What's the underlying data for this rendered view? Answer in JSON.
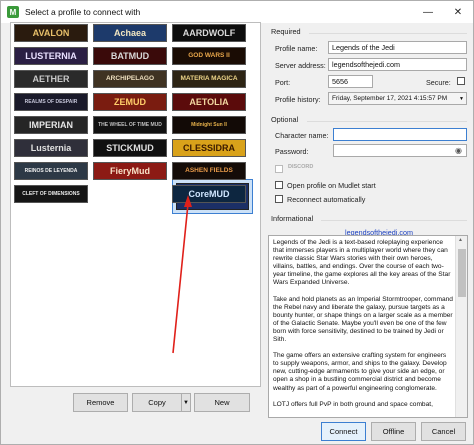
{
  "window": {
    "title": "Select a profile to connect with",
    "app_icon": "mudlet-icon",
    "minimize_glyph": "—",
    "close_glyph": "✕"
  },
  "tiles": [
    {
      "text": "AVALON",
      "bg": "#2a1b0e",
      "fg": "#e8c06a"
    },
    {
      "text": "Achaea",
      "bg": "#1d3a6b",
      "fg": "#f3e7c2"
    },
    {
      "text": "AARDWOLF",
      "bg": "#0d0d0d",
      "fg": "#d9d9d9"
    },
    {
      "text": "LUSTERNIA",
      "bg": "#2b1f44",
      "fg": "#e9e0ff"
    },
    {
      "text": "BATMUD",
      "bg": "#3a0a0a",
      "fg": "#d8d8d8"
    },
    {
      "text": "GOD WARS II",
      "bg": "#1a0c04",
      "fg": "#e8a64a"
    },
    {
      "text": "AETHER",
      "bg": "#2a2a2a",
      "fg": "#c9c9c9"
    },
    {
      "text": "ARCHIPELAGO",
      "bg": "#3f3222",
      "fg": "#efe0c0"
    },
    {
      "text": "MATERIA MAGICA",
      "bg": "#2d2414",
      "fg": "#f0d78a"
    },
    {
      "text": "REALMS OF DESPAIR",
      "bg": "#1a1a2a",
      "fg": "#c5c5d8"
    },
    {
      "text": "ZEMUD",
      "bg": "#7a1c10",
      "fg": "#ffce6a"
    },
    {
      "text": "AETOLIA",
      "bg": "#5b0b0b",
      "fg": "#f2d7a0"
    },
    {
      "text": "IMPERIAN",
      "bg": "#252525",
      "fg": "#e6e6e6"
    },
    {
      "text": "THE WHEEL OF TIME MUD",
      "bg": "#111111",
      "fg": "#bfbfbf"
    },
    {
      "text": "Midnight Sun II",
      "bg": "#120a06",
      "fg": "#e6b04a"
    },
    {
      "text": "Lusternia",
      "bg": "#2f2f3a",
      "fg": "#e0e0e0"
    },
    {
      "text": "STICKMUD",
      "bg": "#101010",
      "fg": "#e0e0e0"
    },
    {
      "text": "CLESSIDRA",
      "bg": "#d9a21a",
      "fg": "#3a1a00"
    },
    {
      "text": "REINOS DE LEYENDA",
      "bg": "#2d3946",
      "fg": "#f0f0f0"
    },
    {
      "text": "FieryMud",
      "bg": "#8c1a14",
      "fg": "#f8e2c8"
    },
    {
      "text": "ASHEN FIELDS",
      "bg": "#140c08",
      "fg": "#e89a4a"
    },
    {
      "text": "CLEFT OF DIMENSIONS",
      "bg": "#151515",
      "fg": "#e8e8e8"
    },
    {
      "text": "LEGENDS OF THE JEDI",
      "bg": "#1b2f66",
      "fg": "#f4f4f4"
    },
    {
      "text": "CoreMUD",
      "bg": "#0d2640",
      "fg": "#d0e6ff"
    }
  ],
  "buttons": {
    "remove": "Remove",
    "copy": "Copy",
    "new": "New",
    "connect": "Connect",
    "offline": "Offline",
    "cancel": "Cancel"
  },
  "required": {
    "heading": "Required",
    "profile_name_label": "Profile name:",
    "profile_name": "Legends of the Jedi",
    "server_label": "Server address:",
    "server": "legendsofthejedi.com",
    "port_label": "Port:",
    "port": "5656",
    "secure_label": "Secure:",
    "history_label": "Profile history:",
    "history": "Friday, September 17, 2021 4:15:57 PM"
  },
  "optional": {
    "heading": "Optional",
    "character_label": "Character name:",
    "character": "",
    "password_label": "Password:",
    "password": "",
    "discord_label": "DISCORD",
    "open_on_start": "Open profile on Mudlet start",
    "reconnect": "Reconnect automatically"
  },
  "informational": {
    "heading": "Informational",
    "website": "legendsofthejedi.com",
    "paragraphs": [
      "Legends of the Jedi is a text-based roleplaying experience that immerses players in a multiplayer world where they can rewrite classic Star Wars stories with their own heroes, villains, battles, and endings. Over the course of each two-year timeline, the game explores all the key areas of the Star Wars Expanded Universe.",
      "Take and hold planets as an Imperial Stormtrooper, command the Rebel navy and liberate the galaxy, pursue targets as a bounty hunter, or shape things on a larger scale as a member of the Galactic Senate. Maybe you'll even be one of the few born with force sensitivity, destined to be trained by Jedi or Sith.",
      "The game offers an extensive crafting system for engineers to supply weapons, armor, and ships to the galaxy. Develop new, cutting-edge armaments to give your side an edge, or open a shop in a bustling commercial district and become wealthy as part of a powerful engineering conglomerate.",
      "LOTJ offers full PvP in both ground and space combat,"
    ]
  },
  "colors": {
    "selection": "#cce1f7",
    "selection_border": "#3c7fd1",
    "arrow": "#e0201a",
    "link": "#1a3fbf"
  }
}
